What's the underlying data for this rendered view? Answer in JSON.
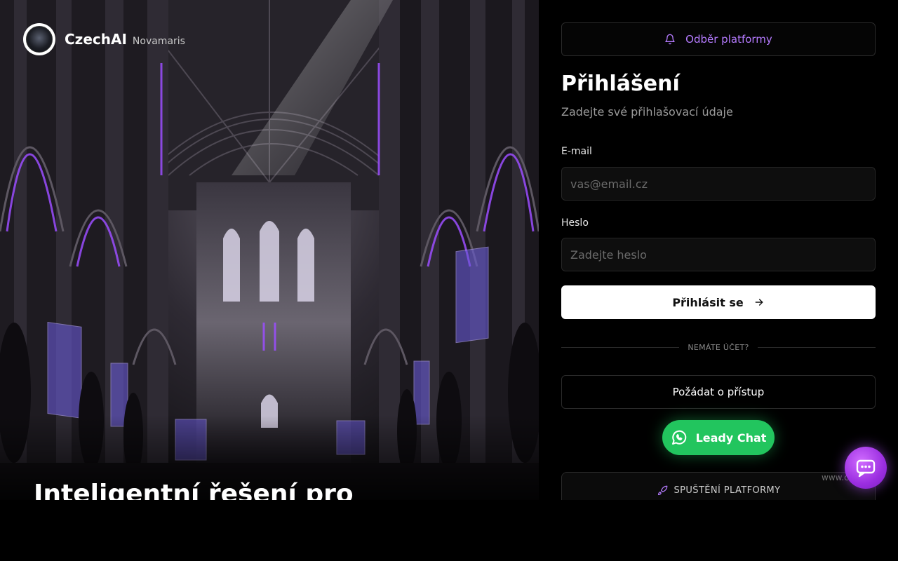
{
  "brand": {
    "name": "CzechAI",
    "subtitle": "Novamaris"
  },
  "hero": {
    "heading": "Inteligentní řešení pro"
  },
  "subscribe": {
    "label": "Odběr platformy",
    "icon": "bell-icon"
  },
  "login": {
    "title": "Přihlášení",
    "subtitle": "Zadejte své přihlašovací údaje",
    "email_label": "E-mail",
    "email_placeholder": "vas@email.cz",
    "password_label": "Heslo",
    "password_placeholder": "Zadejte heslo",
    "submit_label": "Přihlásit se"
  },
  "divider": {
    "text": "NEMÁTE ÚČET?"
  },
  "request": {
    "label": "Požádat o přístup"
  },
  "leady": {
    "label": "Leady Chat",
    "icon": "whatsapp-icon"
  },
  "launch": {
    "label": "SPUŠTĚNÍ PLATFORMY",
    "icon": "rocket-icon"
  },
  "watermark": {
    "text": "www.c"
  },
  "colors": {
    "accent": "#b57bff",
    "whatsapp": "#22c55e",
    "chat_fab": "#a43be8",
    "background": "#000000"
  }
}
